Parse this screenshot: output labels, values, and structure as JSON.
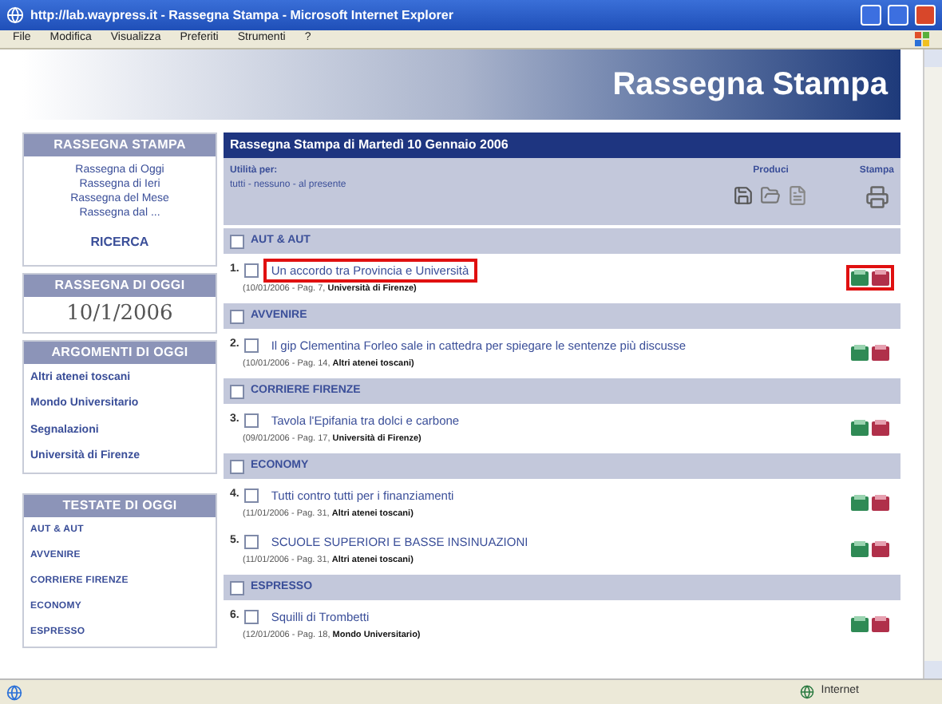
{
  "window": {
    "title": "http://lab.waypress.it - Rassegna Stampa - Microsoft Internet Explorer"
  },
  "menu": [
    "File",
    "Modifica",
    "Visualizza",
    "Preferiti",
    "Strumenti",
    "?"
  ],
  "banner": {
    "title": "Rassegna Stampa"
  },
  "sidebar": [
    {
      "kind": "links",
      "title": "RASSEGNA STAMPA",
      "items": [
        "Rassegna di Oggi",
        "Rassegna di Ieri",
        "Rassegna del Mese",
        "Rassegna dal ..."
      ],
      "extra": "RICERCA"
    },
    {
      "kind": "date",
      "title": "RASSEGNA DI OGGI",
      "value": "10/1/2006"
    },
    {
      "kind": "list",
      "title": "ARGOMENTI DI OGGI",
      "items": [
        "Altri atenei toscani",
        "Mondo Universitario",
        "Segnalazioni",
        "Università di Firenze"
      ]
    },
    {
      "kind": "caps",
      "title": "TESTATE DI OGGI",
      "items": [
        "AUT & AUT",
        "AVVENIRE",
        "CORRIERE FIRENZE",
        "ECONOMY",
        "ESPRESSO"
      ]
    }
  ],
  "main": {
    "title": "Rassegna Stampa di Martedì 10 Gennaio 2006",
    "toolbar": {
      "select_label": "Utilità per:",
      "select_links": "tutti - nessuno - al presente",
      "produce_label": "Produci",
      "print_label": "Stampa"
    },
    "sections": [
      {
        "name": "AUT & AUT",
        "checked": false,
        "articles": [
          {
            "num": "1.",
            "checked": false,
            "highlighted": true,
            "title": "Un accordo tra Provincia e Università",
            "date": "(10/01/2006 - Pag. 7, ",
            "topic": "Università di Firenze)"
          }
        ]
      },
      {
        "name": "AVVENIRE",
        "checked": false,
        "articles": [
          {
            "num": "2.",
            "checked": false,
            "highlighted": false,
            "title": "Il gip Clementina Forleo sale in cattedra per spiegare le sentenze più discusse",
            "date": "(10/01/2006 - Pag. 14, ",
            "topic": "Altri atenei toscani)"
          }
        ]
      },
      {
        "name": "CORRIERE FIRENZE",
        "checked": false,
        "articles": [
          {
            "num": "3.",
            "checked": false,
            "highlighted": false,
            "title": "Tavola l'Epifania tra dolci e carbone",
            "date": "(09/01/2006 - Pag. 17, ",
            "topic": "Università di Firenze)"
          }
        ]
      },
      {
        "name": "ECONOMY",
        "checked": false,
        "articles": [
          {
            "num": "4.",
            "checked": false,
            "highlighted": false,
            "title": "Tutti contro tutti per i finanziamenti",
            "date": "(11/01/2006 - Pag. 31, ",
            "topic": "Altri atenei toscani)"
          },
          {
            "num": "5.",
            "checked": false,
            "highlighted": false,
            "title": "SCUOLE SUPERIORI E BASSE INSINUAZIONI",
            "date": "(11/01/2006 - Pag. 31, ",
            "topic": "Altri atenei toscani)"
          }
        ]
      },
      {
        "name": "ESPRESSO",
        "checked": false,
        "articles": [
          {
            "num": "6.",
            "checked": false,
            "highlighted": false,
            "title": "Squilli di Trombetti",
            "date": "(12/01/2006 - Pag. 18, ",
            "topic": "Mondo Universitario)"
          }
        ]
      }
    ]
  },
  "status_bar": {
    "zone": "Internet"
  }
}
